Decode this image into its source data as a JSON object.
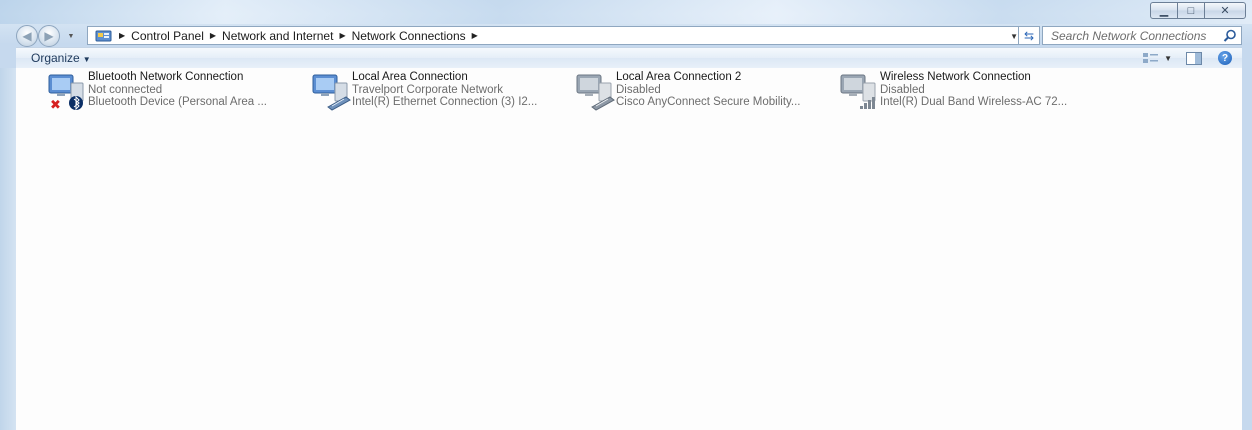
{
  "breadcrumbs": [
    {
      "label": "Control Panel"
    },
    {
      "label": "Network and Internet"
    },
    {
      "label": "Network Connections"
    }
  ],
  "search": {
    "placeholder": "Search Network Connections"
  },
  "toolbar": {
    "organize_label": "Organize"
  },
  "connections": [
    {
      "name": "Bluetooth Network Connection",
      "status": "Not connected",
      "device": "Bluetooth Device (Personal Area ...",
      "icon": "bluetooth-network-icon"
    },
    {
      "name": "Local Area Connection",
      "status": "Travelport Corporate Network",
      "device": "Intel(R) Ethernet Connection (3) I2...",
      "icon": "ethernet-network-icon"
    },
    {
      "name": "Local Area Connection 2",
      "status": "Disabled",
      "device": "Cisco AnyConnect Secure Mobility...",
      "icon": "ethernet-network-disabled-icon"
    },
    {
      "name": "Wireless Network Connection",
      "status": "Disabled",
      "device": "Intel(R) Dual Band Wireless-AC 72...",
      "icon": "wireless-network-disabled-icon"
    }
  ]
}
